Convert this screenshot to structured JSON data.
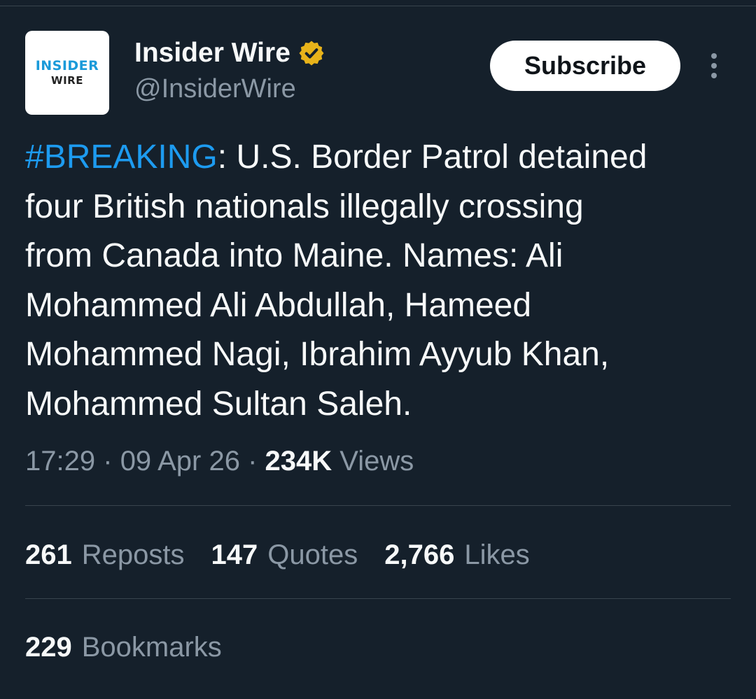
{
  "colors": {
    "background": "#15202b",
    "text_primary": "#f7f9f9",
    "text_secondary": "#8b98a5",
    "hashtag": "#1d9bf0",
    "verified_badge": "#e8b31a",
    "divider": "#38444d"
  },
  "account": {
    "avatar_line1": "INSIDER",
    "avatar_line2": "WIRE",
    "display_name": "Insider Wire",
    "handle": "@InsiderWire",
    "verified_icon": "verified-badge-icon"
  },
  "actions": {
    "subscribe_label": "Subscribe",
    "more_icon": "more-vertical-icon"
  },
  "tweet": {
    "hashtag": "#BREAKING",
    "body": ": U.S. Border Patrol detained\nfour British nationals illegally crossing\nfrom Canada into Maine. Names: Ali\nMohammed Ali Abdullah, Hameed\nMohammed Nagi, Ibrahim Ayyub Khan,\nMohammed Sultan Saleh.",
    "time": "17:29",
    "date": "09 Apr 26",
    "separator": "·",
    "views_count": "234K",
    "views_label": "Views"
  },
  "stats": {
    "reposts_count": "261",
    "reposts_label": "Reposts",
    "quotes_count": "147",
    "quotes_label": "Quotes",
    "likes_count": "2,766",
    "likes_label": "Likes",
    "bookmarks_count": "229",
    "bookmarks_label": "Bookmarks"
  }
}
